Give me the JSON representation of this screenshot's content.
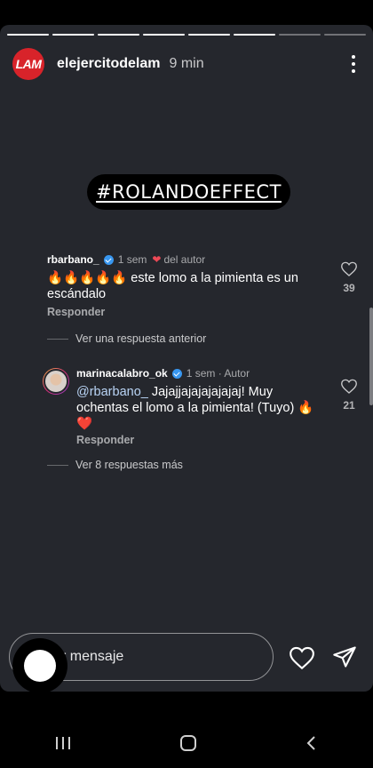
{
  "story": {
    "progress_segments_total": 8,
    "progress_segments_done": 6,
    "logo_text": "LAM",
    "username": "elejercitodelam",
    "time": "9 min",
    "hashtag": "#ROLANDOEFFECT"
  },
  "comments": [
    {
      "user": "rbarbano_",
      "age": "1 sem",
      "author_tag": "del autor",
      "text": "🔥🔥🔥🔥🔥 este lomo a la pimienta es un escándalo",
      "reply_label": "Responder",
      "likes": "39",
      "thread_link": "Ver una respuesta anterior"
    },
    {
      "user": "marinacalabro_ok",
      "age": "1 sem · Autor",
      "mention": "@rbarbano_",
      "text": " Jajajjajajajajajaj! Muy ochentas el lomo a la pimienta! (Tuyo) 🔥❤️",
      "reply_label": "Responder",
      "likes": "21",
      "thread_link": "Ver 8 respuestas más"
    }
  ],
  "composer": {
    "placeholder": "Enviar mensaje"
  },
  "icons": {
    "like": "heart-outline-icon",
    "send": "paper-plane-icon",
    "more": "more-vertical-icon"
  },
  "colors": {
    "accent_red": "#d8232a",
    "verified_blue": "#3897f0",
    "background": "#25272d"
  }
}
